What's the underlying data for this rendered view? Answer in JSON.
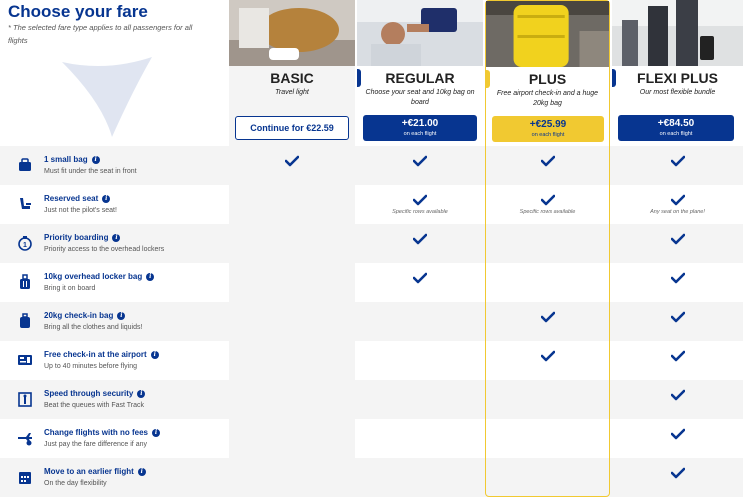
{
  "header": {
    "title": "Choose your fare",
    "subtitle": "* The selected fare type applies to all passengers for all flights"
  },
  "plans": [
    {
      "name": "BASIC",
      "desc": "Travel light",
      "button": "Continue for €22.59"
    },
    {
      "name": "REGULAR",
      "desc": "Choose your seat and 10kg bag on board",
      "price": "+€21.00",
      "per": "on each flight",
      "color": "#073590"
    },
    {
      "name": "PLUS",
      "desc": "Free airport check-in and a huge 20kg bag",
      "price": "+€25.99",
      "per": "on each flight",
      "color": "#f1c931"
    },
    {
      "name": "FLEXI PLUS",
      "desc": "Our most flexible bundle",
      "price": "+€84.50",
      "per": "on each flight",
      "color": "#073590"
    }
  ],
  "features": [
    {
      "title": "1 small bag",
      "sub": "Must fit under the seat in front",
      "icon": "small-bag-icon",
      "checks": [
        true,
        true,
        true,
        true
      ],
      "notes": [
        "",
        "",
        "",
        ""
      ]
    },
    {
      "title": "Reserved seat",
      "sub": "Just not the pilot's seat!",
      "icon": "seat-icon",
      "checks": [
        false,
        true,
        true,
        true
      ],
      "notes": [
        "",
        "Specific rows available",
        "Specific rows available",
        "Any seat on the plane!"
      ]
    },
    {
      "title": "Priority boarding",
      "sub": "Priority access to the overhead lockers",
      "icon": "priority-icon",
      "checks": [
        false,
        true,
        false,
        true
      ],
      "notes": [
        "",
        "",
        "",
        ""
      ]
    },
    {
      "title": "10kg overhead locker bag",
      "sub": "Bring it on board",
      "icon": "cabin-bag-icon",
      "checks": [
        false,
        true,
        false,
        true
      ],
      "notes": [
        "",
        "",
        "",
        ""
      ]
    },
    {
      "title": "20kg check-in bag",
      "sub": "Bring all the clothes and liquids!",
      "icon": "checkin-bag-icon",
      "checks": [
        false,
        false,
        true,
        true
      ],
      "notes": [
        "",
        "",
        "",
        ""
      ]
    },
    {
      "title": "Free check-in at the airport",
      "sub": "Up to 40 minutes before flying",
      "icon": "boarding-pass-icon",
      "checks": [
        false,
        false,
        true,
        true
      ],
      "notes": [
        "",
        "",
        "",
        ""
      ]
    },
    {
      "title": "Speed through security",
      "sub": "Beat the queues with Fast Track",
      "icon": "security-icon",
      "checks": [
        false,
        false,
        false,
        true
      ],
      "notes": [
        "",
        "",
        "",
        ""
      ]
    },
    {
      "title": "Change flights with no fees",
      "sub": "Just pay the fare difference if any",
      "icon": "plane-change-icon",
      "checks": [
        false,
        false,
        false,
        true
      ],
      "notes": [
        "",
        "",
        "",
        ""
      ]
    },
    {
      "title": "Move to an earlier flight",
      "sub": "On the day flexibility",
      "icon": "calendar-icon",
      "checks": [
        false,
        false,
        false,
        true
      ],
      "notes": [
        "",
        "",
        "",
        ""
      ]
    }
  ]
}
